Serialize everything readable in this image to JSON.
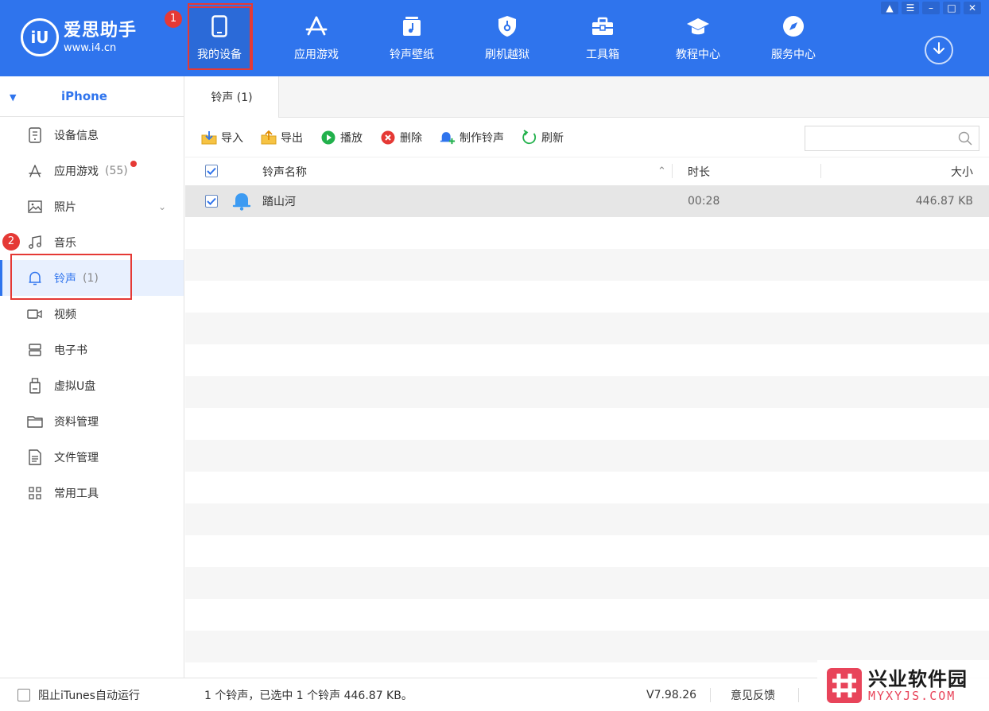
{
  "app": {
    "logo_mark": "iU",
    "name": "爱思助手",
    "url": "www.i4.cn"
  },
  "nav": {
    "items": [
      {
        "label": "我的设备",
        "icon": "phone-icon"
      },
      {
        "label": "应用游戏",
        "icon": "app-store-icon"
      },
      {
        "label": "铃声壁纸",
        "icon": "music-wallpaper-icon"
      },
      {
        "label": "刷机越狱",
        "icon": "shield-key-icon"
      },
      {
        "label": "工具箱",
        "icon": "toolbox-icon"
      },
      {
        "label": "教程中心",
        "icon": "graduation-cap-icon"
      },
      {
        "label": "服务中心",
        "icon": "compass-icon"
      }
    ],
    "active_index": 0
  },
  "window_controls": [
    "shirt-icon",
    "menu-icon",
    "minimize-icon",
    "maximize-icon",
    "close-icon"
  ],
  "annotations": {
    "badge1": "1",
    "badge2": "2"
  },
  "sidebar": {
    "device_name": "iPhone",
    "items": [
      {
        "label": "设备信息",
        "icon": "device-info-icon"
      },
      {
        "label": "应用游戏",
        "count": "(55)",
        "icon": "app-store-icon"
      },
      {
        "label": "照片",
        "icon": "photo-icon"
      },
      {
        "label": "音乐",
        "icon": "music-note-icon"
      },
      {
        "label": "铃声",
        "count": "(1)",
        "icon": "bell-icon"
      },
      {
        "label": "视频",
        "icon": "video-icon"
      },
      {
        "label": "电子书",
        "icon": "ebook-icon"
      },
      {
        "label": "虚拟U盘",
        "icon": "usb-drive-icon"
      },
      {
        "label": "资料管理",
        "icon": "folder-icon"
      },
      {
        "label": "文件管理",
        "icon": "file-icon"
      },
      {
        "label": "常用工具",
        "icon": "grid-icon"
      }
    ],
    "active_index": 4
  },
  "main": {
    "tab_label": "铃声 (1)",
    "toolbar": {
      "import": "导入",
      "export": "导出",
      "play": "播放",
      "delete": "删除",
      "make_ringtone": "制作铃声",
      "refresh": "刷新"
    },
    "search_placeholder": "",
    "columns": {
      "name": "铃声名称",
      "duration": "时长",
      "size": "大小"
    },
    "rows": [
      {
        "name": "踏山河",
        "duration": "00:28",
        "size": "446.87 KB",
        "checked": true
      }
    ]
  },
  "status": {
    "block_itunes": "阻止iTunes自动运行",
    "summary": "1 个铃声，已选中 1 个铃声 446.87 KB。",
    "version": "V7.98.26",
    "feedback": "意见反馈"
  },
  "watermark": {
    "cn": "兴业软件园",
    "en": "MYXYJS.COM"
  },
  "colors": {
    "brand_blue": "#2f74ed",
    "highlight_red": "#e53935",
    "selected_row": "#e6e6e6"
  }
}
